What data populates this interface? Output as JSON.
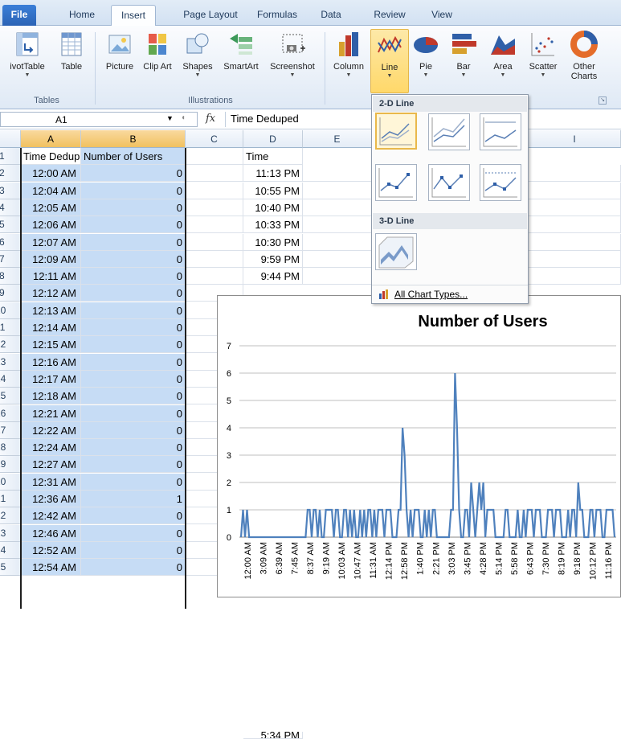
{
  "ribbon": {
    "tabs": [
      "File",
      "Home",
      "Insert",
      "Page Layout",
      "Formulas",
      "Data",
      "Review",
      "View"
    ],
    "active_tab": "Insert",
    "groups": {
      "tables": {
        "label": "Tables",
        "buttons": [
          {
            "label": "ivotTable",
            "icon": "pivottable-icon"
          },
          {
            "label": "Table",
            "icon": "table-icon"
          }
        ]
      },
      "illustrations": {
        "label": "Illustrations",
        "buttons": [
          {
            "label": "Picture",
            "icon": "picture-icon"
          },
          {
            "label": "Clip Art",
            "icon": "clip-art-icon"
          },
          {
            "label": "Shapes",
            "icon": "shapes-icon"
          },
          {
            "label": "SmartArt",
            "icon": "smartart-icon"
          },
          {
            "label": "Screenshot",
            "icon": "screenshot-icon"
          }
        ]
      },
      "charts": {
        "buttons": [
          {
            "label": "Column",
            "icon": "column-chart-icon"
          },
          {
            "label": "Line",
            "icon": "line-chart-icon"
          },
          {
            "label": "Pie",
            "icon": "pie-chart-icon"
          },
          {
            "label": "Bar",
            "icon": "bar-chart-icon"
          },
          {
            "label": "Area",
            "icon": "area-chart-icon"
          },
          {
            "label": "Scatter",
            "icon": "scatter-chart-icon"
          },
          {
            "label": "Other Charts",
            "icon": "other-charts-icon"
          }
        ],
        "selected": "Line"
      }
    }
  },
  "formula_bar": {
    "name_box": "A1",
    "fx": "fx",
    "content": "Time Deduped"
  },
  "grid": {
    "columns": [
      "A",
      "B",
      "C",
      "D",
      "E",
      "I"
    ],
    "row_numbers": [
      "1",
      "2",
      "3",
      "4",
      "5",
      "6",
      "7",
      "8",
      "9",
      "10",
      "11",
      "12",
      "13",
      "14",
      "15",
      "16",
      "17",
      "18",
      "19",
      "20",
      "21",
      "22",
      "23",
      "24",
      "25"
    ],
    "header_a": "Time Deduped",
    "header_b": "Number of Users",
    "header_d": "Time",
    "col_a": [
      "12:00 AM",
      "12:04 AM",
      "12:05 AM",
      "12:06 AM",
      "12:07 AM",
      "12:09 AM",
      "12:11 AM",
      "12:12 AM",
      "12:13 AM",
      "12:14 AM",
      "12:15 AM",
      "12:16 AM",
      "12:17 AM",
      "12:18 AM",
      "12:21 AM",
      "12:22 AM",
      "12:24 AM",
      "12:27 AM",
      "12:31 AM",
      "12:36 AM",
      "12:42 AM",
      "12:46 AM",
      "12:52 AM",
      "12:54 AM"
    ],
    "col_b": [
      "0",
      "0",
      "0",
      "0",
      "0",
      "0",
      "0",
      "0",
      "0",
      "0",
      "0",
      "0",
      "0",
      "0",
      "0",
      "0",
      "0",
      "0",
      "0",
      "1",
      "0",
      "0",
      "0",
      "0"
    ],
    "col_d": [
      "11:13 PM",
      "10:55 PM",
      "10:40 PM",
      "10:33 PM",
      "10:30 PM",
      "9:59 PM",
      "9:44 PM"
    ],
    "col_d_last": "5:34 PM"
  },
  "gallery": {
    "section_2d": "2-D Line",
    "section_3d": "3-D Line",
    "all_chart_types": "All Chart Types...",
    "items_2d": [
      "line-chart-thumbnail",
      "stacked-line-chart-thumbnail",
      "100-percent-stacked-line-chart-thumbnail",
      "line-with-markers-thumbnail",
      "stacked-line-with-markers-thumbnail",
      "100-percent-stacked-line-with-markers-thumbnail"
    ],
    "items_3d": [
      "3d-line-chart-thumbnail"
    ]
  },
  "colors": {
    "series": "#4f81bd",
    "selection": "#c6dcf5",
    "ribbon_highlight": "#ffd86a"
  },
  "chart_data": {
    "type": "area",
    "title": "Number of Users",
    "xlabel": "",
    "ylabel": "",
    "ylim": [
      0,
      7
    ],
    "yticks": [
      0,
      1,
      2,
      3,
      4,
      5,
      6,
      7
    ],
    "grid": true,
    "x_tick_labels": [
      "12:00 AM",
      "3:09 AM",
      "6:39 AM",
      "7:45 AM",
      "8:37 AM",
      "9:19 AM",
      "10:03 AM",
      "10:47 AM",
      "11:31 AM",
      "12:14 PM",
      "12:58 PM",
      "1:40 PM",
      "2:21 PM",
      "3:03 PM",
      "3:45 PM",
      "4:28 PM",
      "5:14 PM",
      "5:58 PM",
      "6:43 PM",
      "7:30 PM",
      "8:19 PM",
      "9:18 PM",
      "10:12 PM",
      "11:16 PM"
    ],
    "values": [
      0,
      1,
      0,
      1,
      0,
      0,
      0,
      0,
      0,
      0,
      0,
      0,
      0,
      0,
      0,
      0,
      0,
      0,
      0,
      0,
      0,
      0,
      0,
      0,
      0,
      0,
      0,
      0,
      0,
      0,
      0,
      0,
      0,
      1,
      1,
      0,
      1,
      1,
      0,
      1,
      0,
      0,
      1,
      1,
      1,
      1,
      0,
      1,
      1,
      0,
      0,
      1,
      1,
      0,
      1,
      0,
      1,
      0,
      0,
      1,
      0,
      1,
      0,
      1,
      1,
      0,
      1,
      0,
      1,
      1,
      1,
      0,
      1,
      1,
      1,
      0,
      0,
      0,
      1,
      1,
      4,
      3,
      1,
      0,
      1,
      0,
      1,
      1,
      1,
      0,
      0,
      1,
      0,
      1,
      0,
      1,
      1,
      0,
      0,
      0,
      0,
      0,
      0,
      0,
      1,
      1,
      6,
      4,
      1,
      0,
      0,
      1,
      1,
      0,
      2,
      1,
      0,
      1,
      2,
      1,
      2,
      0,
      1,
      1,
      1,
      1,
      0,
      0,
      0,
      0,
      0,
      1,
      1,
      0,
      0,
      0,
      0,
      1,
      0,
      0,
      1,
      0,
      1,
      1,
      1,
      0,
      1,
      1,
      1,
      0,
      0,
      0,
      1,
      1,
      1,
      0,
      1,
      1,
      1,
      0,
      0,
      0,
      1,
      0,
      1,
      1,
      0,
      2,
      1,
      1,
      0,
      0,
      0,
      1,
      1,
      0,
      1,
      1,
      1,
      0,
      0,
      1,
      1,
      1,
      1,
      0
    ]
  }
}
